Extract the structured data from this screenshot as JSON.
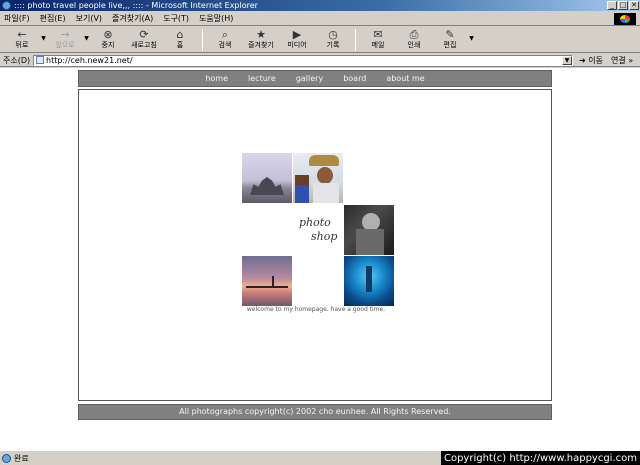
{
  "window": {
    "title": ":::: photo travel people live,,, :::: - Microsoft Internet Explorer",
    "min_label": "_",
    "max_label": "□",
    "close_label": "✕"
  },
  "menu": [
    "파일(F)",
    "편집(E)",
    "보기(V)",
    "즐겨찾기(A)",
    "도구(T)",
    "도움말(H)"
  ],
  "toolbar": {
    "back": {
      "icon": "←",
      "label": "뒤로"
    },
    "forward": {
      "icon": "→",
      "label": "앞으로"
    },
    "stop": {
      "icon": "⊗",
      "label": "중지"
    },
    "refresh": {
      "icon": "⟳",
      "label": "새로고침"
    },
    "home": {
      "icon": "⌂",
      "label": "홈"
    },
    "search": {
      "icon": "⌕",
      "label": "검색"
    },
    "favorites": {
      "icon": "★",
      "label": "즐겨찾기"
    },
    "media": {
      "icon": "▶",
      "label": "미디어"
    },
    "history": {
      "icon": "◷",
      "label": "기록"
    },
    "mail": {
      "icon": "✉",
      "label": "메일"
    },
    "print": {
      "icon": "⎙",
      "label": "인쇄"
    },
    "edit": {
      "icon": "✎",
      "label": "편집"
    }
  },
  "address": {
    "label": "주소(D)",
    "url": "http://ceh.new21.net/",
    "go_label": "이동",
    "links_label": "연결 »"
  },
  "page": {
    "nav": [
      "home",
      "lecture",
      "gallery",
      "board",
      "about me"
    ],
    "logo_line1": "photo",
    "logo_line2": "shop",
    "welcome": "welcome to my homepage. have a good time.",
    "footer": "All photographs copyright(c) 2002 cho eunhee. All Rights Reserved."
  },
  "status": {
    "text": "완료",
    "copyright": "Copyright(c) http://www.happycgi.com"
  }
}
